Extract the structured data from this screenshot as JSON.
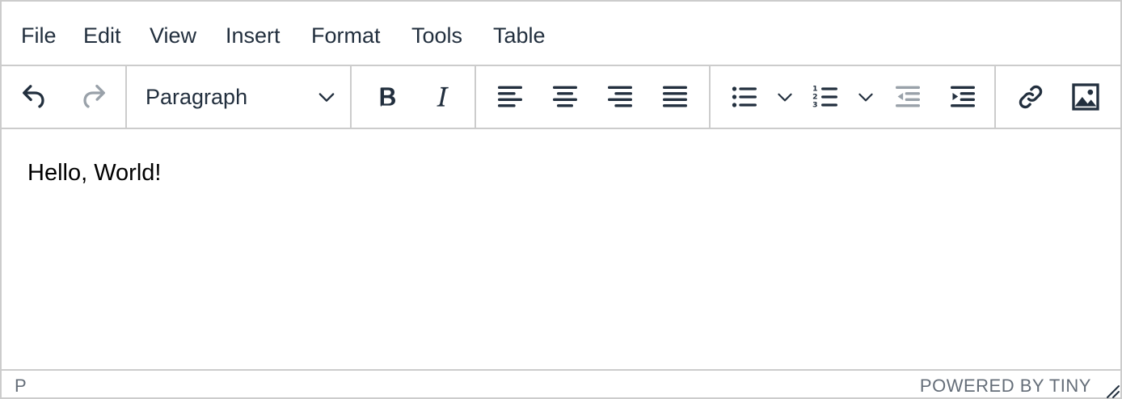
{
  "menubar": {
    "items": [
      {
        "label": "File"
      },
      {
        "label": "Edit"
      },
      {
        "label": "View"
      },
      {
        "label": "Insert"
      },
      {
        "label": "Format"
      },
      {
        "label": "Tools"
      },
      {
        "label": "Table"
      }
    ]
  },
  "toolbar": {
    "block_format": "Paragraph",
    "buttons": [
      "undo-icon",
      "redo-icon",
      "chevron-down-icon",
      "bold-icon",
      "italic-icon",
      "align-left-icon",
      "align-center-icon",
      "align-right-icon",
      "align-justify-icon",
      "bullet-list-icon",
      "numbered-list-icon",
      "outdent-icon",
      "indent-icon",
      "link-icon",
      "image-icon"
    ]
  },
  "content": {
    "paragraph": "Hello, World!"
  },
  "statusbar": {
    "path": "P",
    "branding": "POWERED BY TINY"
  },
  "colors": {
    "icon": "#222f3e",
    "icon_disabled": "#99a1a9",
    "border": "#cccccc"
  }
}
